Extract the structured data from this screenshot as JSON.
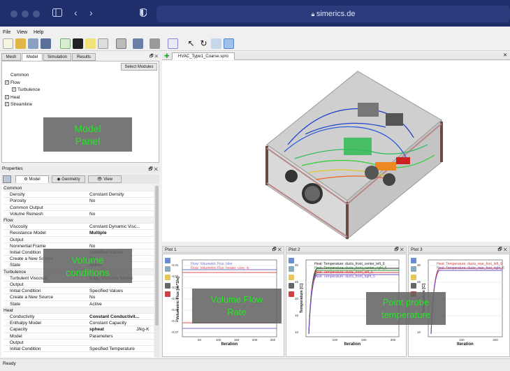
{
  "browser": {
    "url": "simerics.de"
  },
  "menu": [
    "File",
    "View",
    "Help"
  ],
  "left": {
    "tabs": [
      "Mesh",
      "Model",
      "Simulation",
      "Results"
    ],
    "select_modules": "Select Modules",
    "tree": [
      {
        "label": "Common",
        "indent": 0,
        "cb": false
      },
      {
        "label": "Flow",
        "indent": 0,
        "cb": true
      },
      {
        "label": "Turbulence",
        "indent": 1,
        "cb": true
      },
      {
        "label": "Heat",
        "indent": 0,
        "cb": true
      },
      {
        "label": "Streamline",
        "indent": 0,
        "cb": true
      }
    ],
    "overlay_model": "Model\nPanel",
    "properties_title": "Properties",
    "prop_tabs": [
      "Model",
      "Geometry",
      "View"
    ],
    "props": [
      {
        "k": "Common",
        "v": "",
        "lvl": 0
      },
      {
        "k": "Density",
        "v": "Constant Density",
        "lvl": 1
      },
      {
        "k": "Porosity",
        "v": "No",
        "lvl": 1
      },
      {
        "k": "Common Output",
        "v": "",
        "lvl": 1
      },
      {
        "k": "Volume Remesh",
        "v": "No",
        "lvl": 1
      },
      {
        "k": "Flow",
        "v": "",
        "lvl": 0
      },
      {
        "k": "Viscosity",
        "v": "Constant Dynamic Visc...",
        "lvl": 1
      },
      {
        "k": "Resistance Model",
        "v": "Multiple",
        "lvl": 1
      },
      {
        "k": "Output",
        "v": "",
        "lvl": 1
      },
      {
        "k": "Noninertial Frame",
        "v": "No",
        "lvl": 1
      },
      {
        "k": "Initial Condition",
        "v": "Specified Values",
        "lvl": 1
      },
      {
        "k": "Create a New Source",
        "v": "No",
        "lvl": 1
      },
      {
        "k": "State",
        "v": "Active",
        "lvl": 1
      },
      {
        "k": "Turbulence",
        "v": "",
        "lvl": 0
      },
      {
        "k": "Turbulent Viscosity",
        "v": "Eddy Viscosity Model",
        "lvl": 1
      },
      {
        "k": "Output",
        "v": "",
        "lvl": 1
      },
      {
        "k": "Initial Condition",
        "v": "Specified Values",
        "lvl": 1
      },
      {
        "k": "Create a New Source",
        "v": "No",
        "lvl": 1
      },
      {
        "k": "State",
        "v": "Active",
        "lvl": 1
      },
      {
        "k": "Heat",
        "v": "",
        "lvl": 0
      },
      {
        "k": "Conductivity",
        "v": "Constant Conductivit...",
        "lvl": 1
      },
      {
        "k": "Enthalpy Model",
        "v": "Constant Capacity",
        "lvl": 1
      },
      {
        "k": "Capacity",
        "v": "spheat",
        "lvl": 1
      },
      {
        "k": "Model",
        "v": "Parameters",
        "lvl": 1
      },
      {
        "k": "Output",
        "v": "",
        "lvl": 1
      },
      {
        "k": "Initial Condition",
        "v": "Specified Temperature",
        "lvl": 1
      }
    ],
    "capacity_unit": "J/kg-K",
    "overlay_volume": "Volume\nconditions"
  },
  "viewer": {
    "tab": "HVAC_Type1_Coarse.spro"
  },
  "plots": [
    {
      "title": "Plot 1",
      "ylabel": "Volumetric Flux [m^3/s]",
      "xlabel": "Iteration",
      "yticks": [
        "-0.01",
        "-0.02",
        "-0.03",
        "-0.04",
        "-0.05",
        "-0.06",
        "-0.07"
      ],
      "xticks": [
        "50",
        "100",
        "150",
        "200",
        "250"
      ],
      "legend": [
        "Flow: Volumetric Flux: inlet",
        "Flow: Volumetric Flux: heater_core_in"
      ],
      "overlay": "Volume Flow\nRate"
    },
    {
      "title": "Plot 2",
      "ylabel": "Temperature [C]",
      "xlabel": "Iteration",
      "yticks": [
        "30",
        "25",
        "20",
        "15",
        "10"
      ],
      "xticks": [
        "100",
        "200",
        "300"
      ],
      "legend": [
        "Heat: Temperature: ducts_front_center_left_6",
        "Heat: Temperature: ducts_front_center_right_6",
        "Heat: Temperature: ducts_front_left_6",
        "Heat: Temperature: ducts_front_right_6"
      ],
      "overlay": "Point probe\ntemperature"
    },
    {
      "title": "Plot 3",
      "ylabel": "Temperature [C]",
      "xlabel": "Iteration",
      "yticks": [
        "30",
        "25",
        "20",
        "15",
        "10"
      ],
      "xticks": [
        "100",
        "200"
      ],
      "legend": [
        "Heat: Temperature: ducts_rear_foot_left_6",
        "Heat: Temperature: ducts_rear_foot_right_6"
      ]
    }
  ],
  "status": "Ready"
}
